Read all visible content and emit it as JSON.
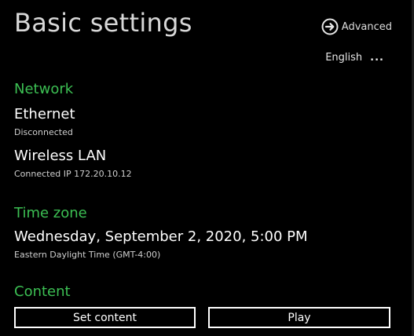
{
  "header": {
    "title": "Basic settings",
    "advanced_label": "Advanced",
    "language": "English",
    "language_more": "..."
  },
  "network": {
    "heading": "Network",
    "ethernet": {
      "label": "Ethernet",
      "status": "Disconnected"
    },
    "wireless": {
      "label": "Wireless LAN",
      "status": "Connected IP 172.20.10.12"
    }
  },
  "timezone": {
    "heading": "Time zone",
    "datetime": "Wednesday, September 2, 2020, 5:00 PM",
    "zone": "Eastern Daylight Time (GMT-4:00)"
  },
  "content": {
    "heading": "Content",
    "set_content_label": "Set content",
    "play_label": "Play"
  },
  "colors": {
    "background": "#000000",
    "accent_green": "#3cbf53",
    "text": "#ffffff"
  }
}
